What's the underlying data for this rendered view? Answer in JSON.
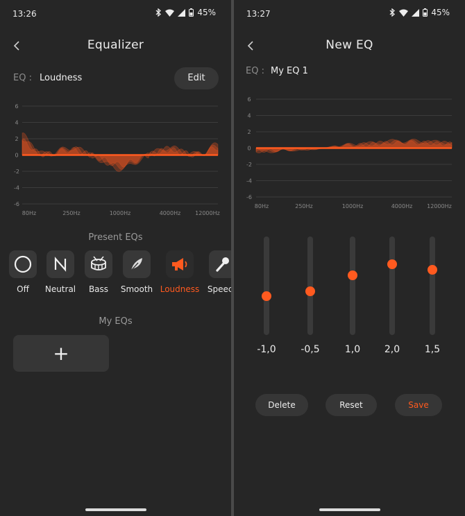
{
  "left_screen": {
    "status": {
      "time": "13:26",
      "battery": "45%"
    },
    "title": "Equalizer",
    "eq_label": "EQ :",
    "eq_name": "Loudness",
    "edit_label": "Edit",
    "chart_data": {
      "type": "area",
      "y_ticks": [
        "6",
        "4",
        "2",
        "0",
        "-2",
        "-4",
        "-6"
      ],
      "x_ticks": [
        "80Hz",
        "250Hz",
        "1000Hz",
        "4000Hz",
        "12000Hz"
      ],
      "ylim": [
        -6,
        6
      ],
      "accent": "#ff5a1f"
    },
    "presets_title": "Present EQs",
    "presets": [
      {
        "label": "Off",
        "icon": "circle-icon"
      },
      {
        "label": "Neutral",
        "icon": "letter-n-icon"
      },
      {
        "label": "Bass",
        "icon": "drum-icon"
      },
      {
        "label": "Smooth",
        "icon": "feather-icon"
      },
      {
        "label": "Loudness",
        "icon": "megaphone-icon",
        "active": true
      },
      {
        "label": "Speech",
        "icon": "microphone-icon"
      }
    ],
    "my_eqs_title": "My EQs",
    "add_label": "+"
  },
  "right_screen": {
    "status": {
      "time": "13:27",
      "battery": "45%"
    },
    "title": "New EQ",
    "eq_label": "EQ :",
    "eq_name": "My EQ 1",
    "chart_data": {
      "type": "area",
      "y_ticks": [
        "6",
        "4",
        "2",
        "0",
        "-2",
        "-4",
        "-6"
      ],
      "x_ticks": [
        "80Hz",
        "250Hz",
        "1000Hz",
        "4000Hz",
        "12000Hz"
      ],
      "ylim": [
        -6,
        6
      ],
      "accent": "#ff5a1f"
    },
    "sliders": [
      {
        "value": -1.0,
        "label": "-1,0"
      },
      {
        "value": -0.5,
        "label": "-0,5"
      },
      {
        "value": 1.0,
        "label": "1,0"
      },
      {
        "value": 2.0,
        "label": "2,0"
      },
      {
        "value": 1.5,
        "label": "1,5"
      }
    ],
    "buttons": {
      "delete": "Delete",
      "reset": "Reset",
      "save": "Save"
    }
  },
  "colors": {
    "accent": "#ff5a1f",
    "background": "#262626",
    "surface": "#363636"
  }
}
